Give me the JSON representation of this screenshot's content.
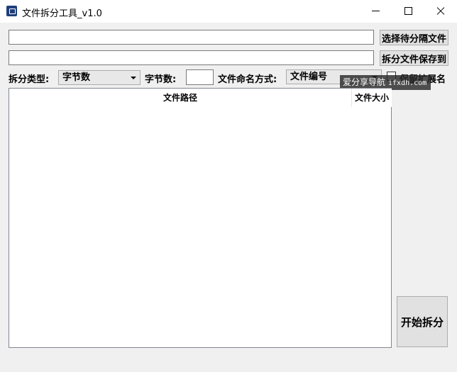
{
  "window": {
    "title": "文件拆分工具_v1.0"
  },
  "controls": {
    "source_path": {
      "value": "",
      "placeholder": ""
    },
    "select_button_label": "选择待分隔文件",
    "output_path": {
      "value": "",
      "placeholder": ""
    },
    "save_button_label": "拆分文件保存到",
    "split_type_label": "拆分类型:",
    "split_type_value": "字节数",
    "byte_count_label": "字节数:",
    "byte_count_value": "",
    "naming_label": "文件命名方式:",
    "naming_value": "文件编号",
    "keep_ext_label": "保留扩展名",
    "keep_ext_checked": false
  },
  "file_list": {
    "columns": [
      "文件路径",
      "文件大小"
    ],
    "rows": []
  },
  "start_button_label": "开始拆分",
  "watermark": {
    "text": "爱分享导航",
    "domain": "ifxdh.com"
  }
}
